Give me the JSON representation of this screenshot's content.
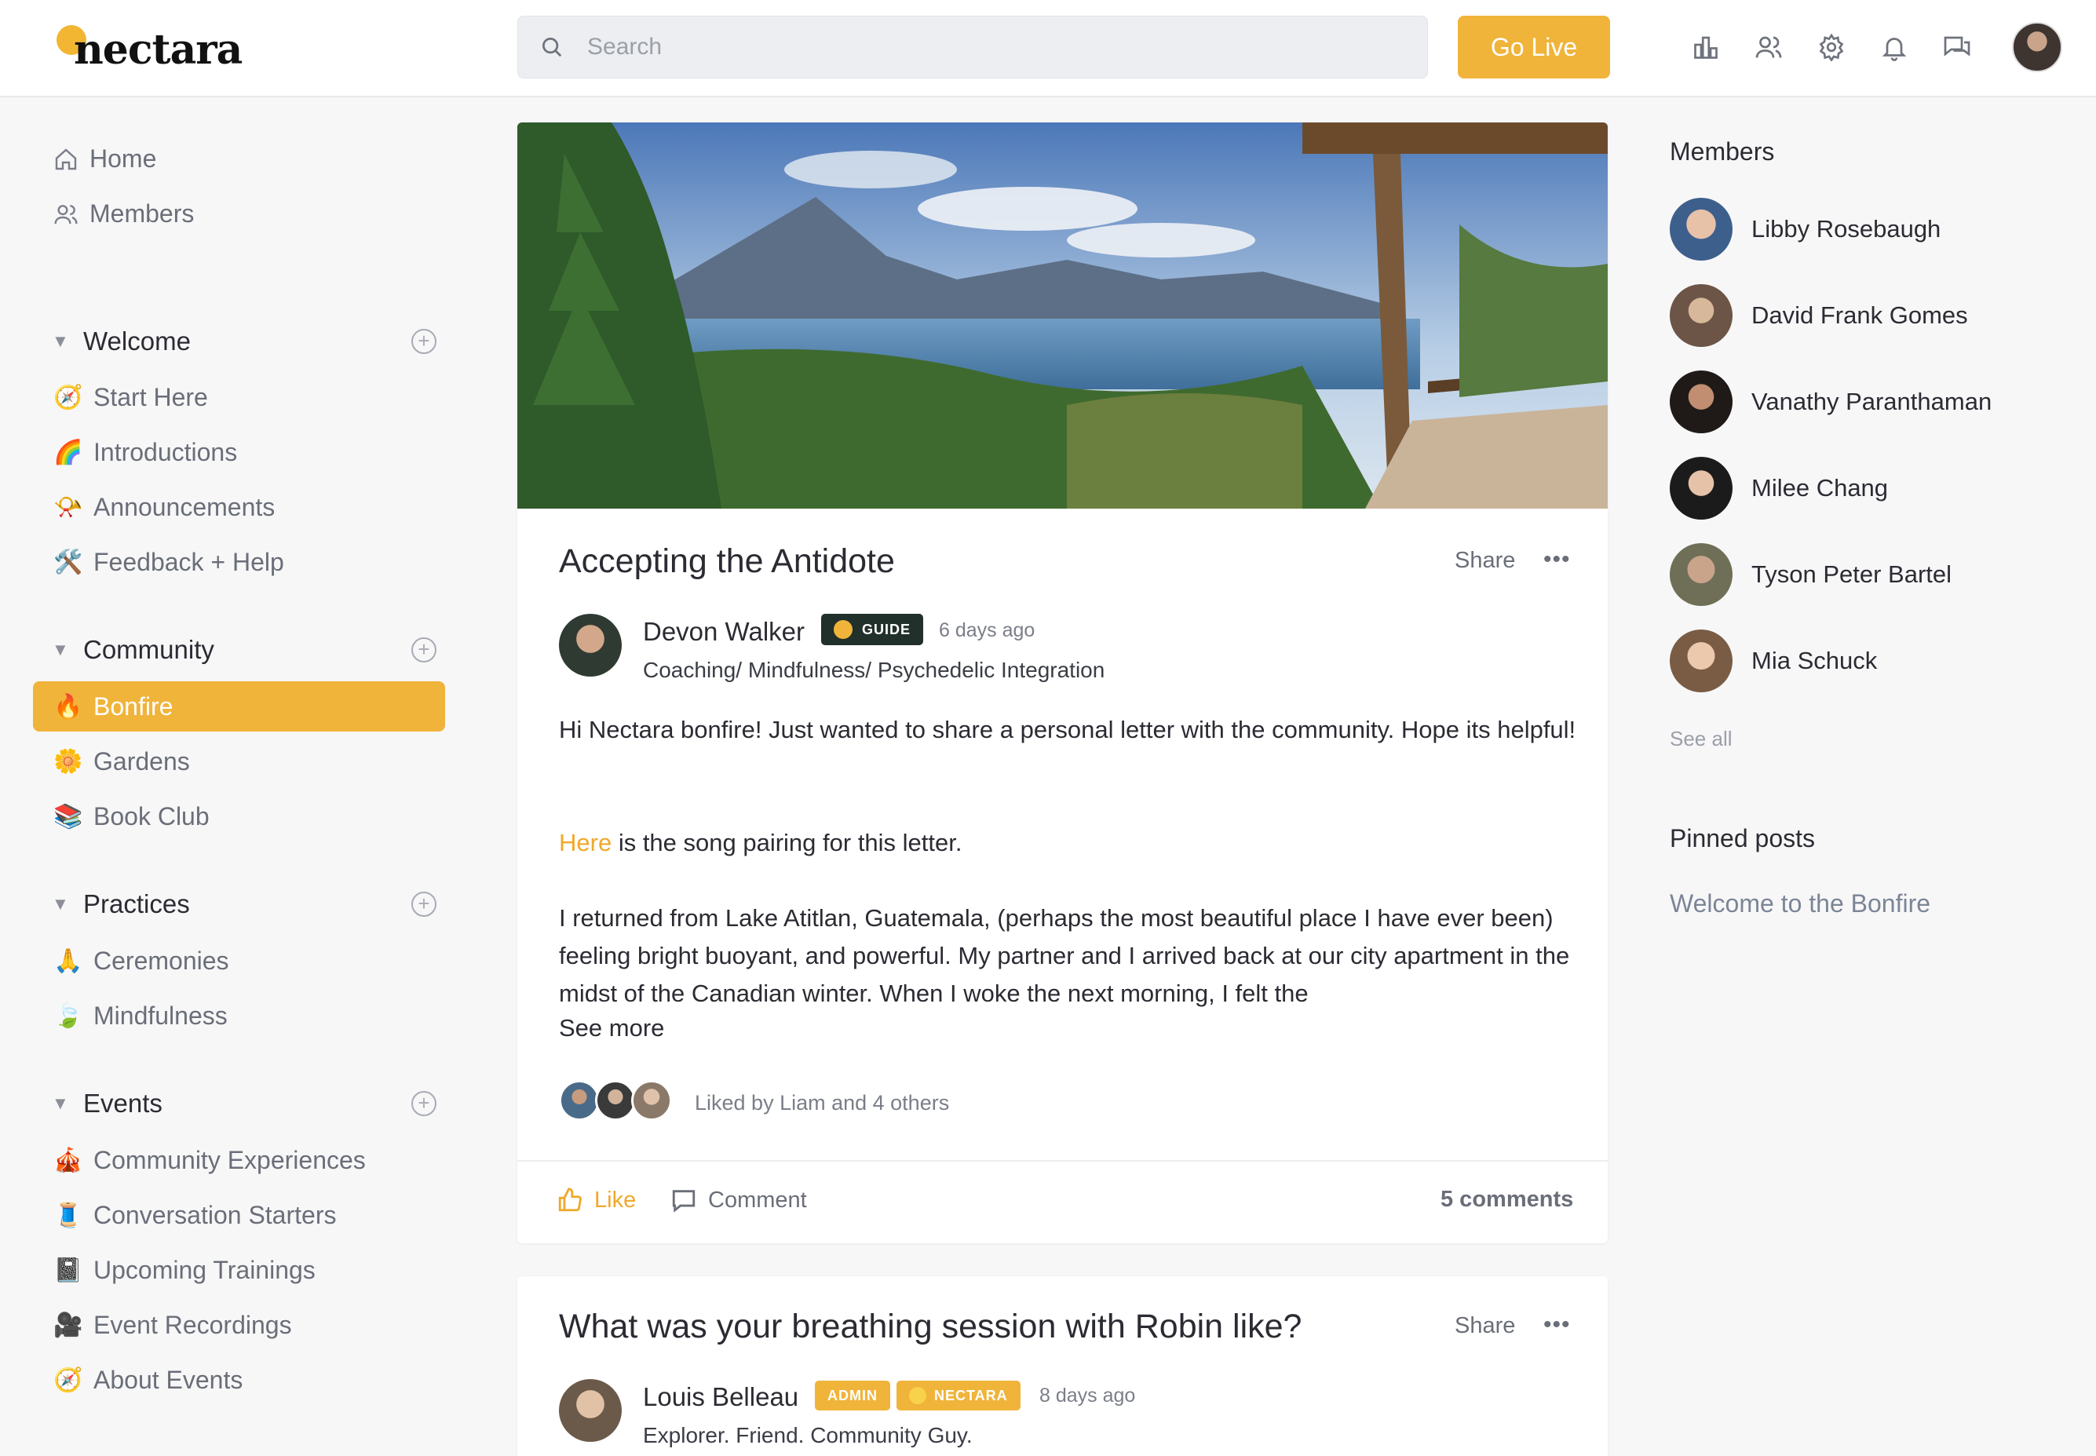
{
  "brand": {
    "name": "nectara",
    "accent": "#f0b43a"
  },
  "header": {
    "search_placeholder": "Search",
    "go_live_label": "Go Live",
    "icons": [
      "leaderboard-icon",
      "members-icon",
      "settings-icon",
      "notifications-icon",
      "messages-icon"
    ]
  },
  "sidebar": {
    "top": [
      {
        "label": "Home",
        "icon": "home-icon"
      },
      {
        "label": "Members",
        "icon": "members-icon"
      }
    ],
    "sections": [
      {
        "title": "Welcome",
        "channels": [
          {
            "emoji": "🧭",
            "label": "Start Here"
          },
          {
            "emoji": "🌈",
            "label": "Introductions"
          },
          {
            "emoji": "📯",
            "label": "Announcements"
          },
          {
            "emoji": "🛠️",
            "label": "Feedback + Help"
          }
        ]
      },
      {
        "title": "Community",
        "channels": [
          {
            "emoji": "🔥",
            "label": "Bonfire",
            "active": true
          },
          {
            "emoji": "🌼",
            "label": "Gardens"
          },
          {
            "emoji": "📚",
            "label": "Book Club"
          }
        ]
      },
      {
        "title": "Practices",
        "channels": [
          {
            "emoji": "🙏",
            "label": "Ceremonies"
          },
          {
            "emoji": "🍃",
            "label": "Mindfulness"
          }
        ]
      },
      {
        "title": "Events",
        "channels": [
          {
            "emoji": "🎪",
            "label": "Community Experiences"
          },
          {
            "emoji": "🧵",
            "label": "Conversation Starters"
          },
          {
            "emoji": "📓",
            "label": "Upcoming Trainings"
          },
          {
            "emoji": "🎥",
            "label": "Event Recordings"
          },
          {
            "emoji": "🧭",
            "label": "About Events"
          }
        ]
      }
    ]
  },
  "posts": [
    {
      "title": "Accepting the Antidote",
      "share_label": "Share",
      "more_label": "•••",
      "author": "Devon Walker",
      "badges": [
        {
          "label": "GUIDE",
          "color": "#21302a"
        }
      ],
      "time": "6 days ago",
      "author_subtitle": "Coaching/ Mindfulness/ Psychedelic Integration",
      "body": {
        "p1": "Hi Nectara bonfire! Just wanted to share a personal letter with the community. Hope its helpful!",
        "p2_link": "Here",
        "p2_rest": " is the song pairing for this letter.",
        "p3": "I returned from Lake Atitlan, Guatemala, (perhaps the most beautiful place I have ever been) feeling bright buoyant, and powerful. My partner and I arrived back at our city apartment in the midst of the Canadian winter. When I woke the next morning, I felt the",
        "see_more": "See more"
      },
      "likes_text": "Liked by Liam and 4 others",
      "actions": {
        "like": "Like",
        "comment": "Comment",
        "comments_count": "5 comments"
      }
    },
    {
      "title": "What was your breathing session with Robin like?",
      "share_label": "Share",
      "more_label": "•••",
      "author": "Louis Belleau",
      "badges": [
        {
          "label": "ADMIN",
          "color": "#f0b43a"
        },
        {
          "label": "NECTARA",
          "color": "#f0b43a"
        }
      ],
      "time": "8 days ago",
      "author_subtitle": "Explorer. Friend. Community Guy."
    }
  ],
  "right": {
    "members_title": "Members",
    "members": [
      "Libby Rosebaugh",
      "David Frank Gomes",
      "Vanathy Paranthaman",
      "Milee Chang",
      "Tyson Peter Bartel",
      "Mia Schuck"
    ],
    "see_all": "See all",
    "pinned_title": "Pinned posts",
    "pinned": [
      "Welcome to the Bonfire"
    ]
  }
}
